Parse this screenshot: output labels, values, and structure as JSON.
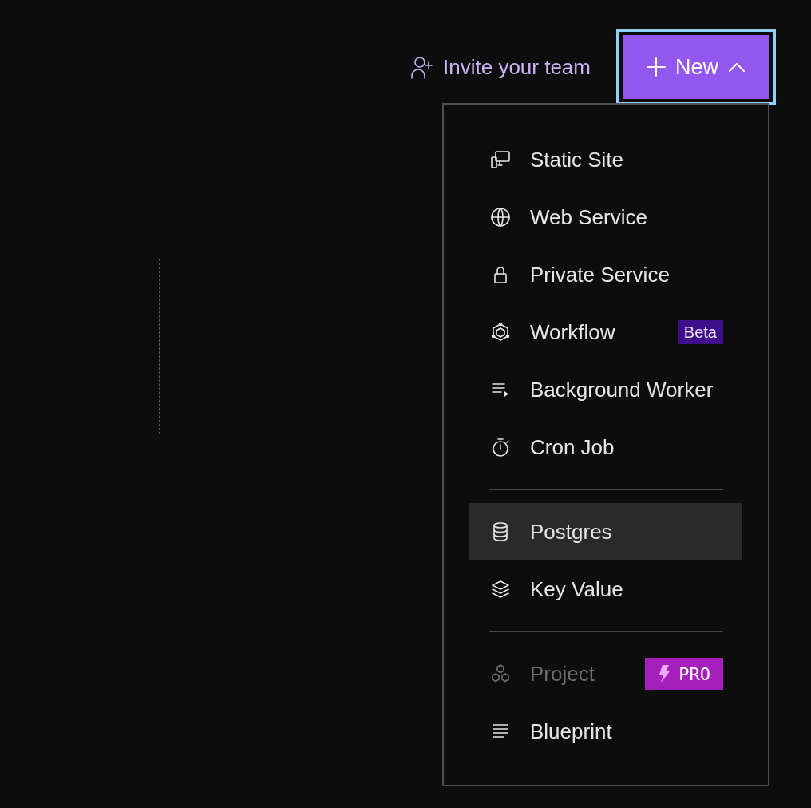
{
  "header": {
    "invite_link": "Invite your team",
    "new_button": {
      "label": "New",
      "expanded": true,
      "focused": true
    }
  },
  "menu": {
    "sections": [
      {
        "items": [
          {
            "label": "Static Site",
            "selected": false,
            "disabled": false
          },
          {
            "label": "Web Service",
            "selected": false,
            "disabled": false
          },
          {
            "label": "Private Service",
            "selected": false,
            "disabled": false
          },
          {
            "label": "Workflow",
            "selected": false,
            "disabled": false,
            "badge": {
              "kind": "beta",
              "text": "Beta"
            }
          },
          {
            "label": "Background Worker",
            "selected": false,
            "disabled": false
          },
          {
            "label": "Cron Job",
            "selected": false,
            "disabled": false
          }
        ]
      },
      {
        "items": [
          {
            "label": "Postgres",
            "selected": true,
            "disabled": false
          },
          {
            "label": "Key Value",
            "selected": false,
            "disabled": false
          }
        ]
      },
      {
        "items": [
          {
            "label": "Project",
            "selected": false,
            "disabled": true,
            "badge": {
              "kind": "pro",
              "text": "PRO"
            }
          },
          {
            "label": "Blueprint",
            "selected": false,
            "disabled": false
          }
        ]
      }
    ]
  }
}
